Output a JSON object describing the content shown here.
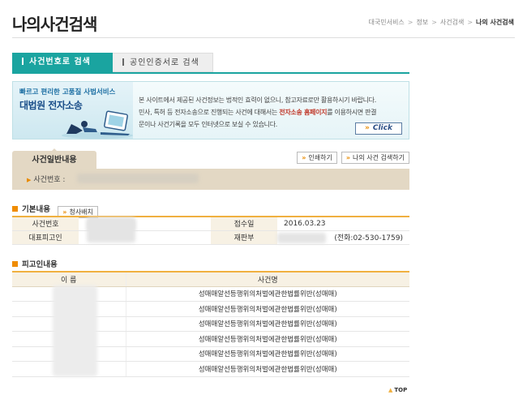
{
  "page": {
    "title": "나의사건검색",
    "breadcrumb": [
      "대국민서비스",
      "정보",
      "사건검색",
      "나의 사건검색"
    ]
  },
  "tabs": [
    {
      "label": "사건번호로 검색",
      "active": true
    },
    {
      "label": "공인인증서로 검색",
      "active": false
    }
  ],
  "banner": {
    "subtitle": "빠르고 편리한 고품질 사법서비스",
    "title": "대법원 전자소송",
    "text_line1": "본 사이트에서 제공된 사건정보는 법적인 효력이 없으니, 참고자료로만 활용하시기 바랍니다.",
    "text_line2_a": "민사, 특허 등 전자소송으로 진행되는 사건에 대해서는 ",
    "text_line2_hl": "전자소송 홈페이지",
    "text_line2_b": "를 이용하시면 판결",
    "text_line3": "문이나 사건기록을 모두 인터넷으로 보실 수 있습니다.",
    "click_label": "Click"
  },
  "case_header": {
    "tab_label": "사건일반내용",
    "case_no_label": "사건번호 : "
  },
  "actions": {
    "print_label": "인쇄하기",
    "my_search_label": "나의 사건 검색하기"
  },
  "basic": {
    "section_title": "기본내용",
    "appeal_button": "청사배치",
    "rows": [
      {
        "label1": "사건번호",
        "value1": "",
        "label2": "접수일",
        "value2": "2016.03.23"
      },
      {
        "label1": "대표피고인",
        "value1": "",
        "label2": "재판부",
        "value2": "(전화:02-530-1759)"
      }
    ]
  },
  "defendants": {
    "section_title": "피고인내용",
    "columns": [
      "이 름",
      "사건명"
    ],
    "rows": [
      {
        "name": "",
        "case_name": "성매매알선등행위의처벌에관한법률위반(성매매)"
      },
      {
        "name": "",
        "case_name": "성매매알선등행위의처벌에관한법률위반(성매매)"
      },
      {
        "name": "",
        "case_name": "성매매알선등행위의처벌에관한법률위반(성매매)"
      },
      {
        "name": "",
        "case_name": "성매매알선등행위의처벌에관한법률위반(성매매)"
      },
      {
        "name": "",
        "case_name": "성매매알선등행위의처벌에관한법률위반(성매매)"
      },
      {
        "name": "",
        "case_name": "성매매알선등행위의처벌에관한법률위반(성매매)"
      }
    ]
  },
  "top_link": "TOP",
  "colors": {
    "accent_teal": "#1aa4a0",
    "case_bar_beige": "#e3d8c4",
    "table_header_bg": "#f7f1e4",
    "bullet_orange": "#f08c00",
    "highlight_red": "#c0392b"
  },
  "icons": {
    "section_bullet": "square-bullet-icon",
    "arrow": "double-chevron-right-icon",
    "top_arrow": "triangle-up-icon"
  }
}
